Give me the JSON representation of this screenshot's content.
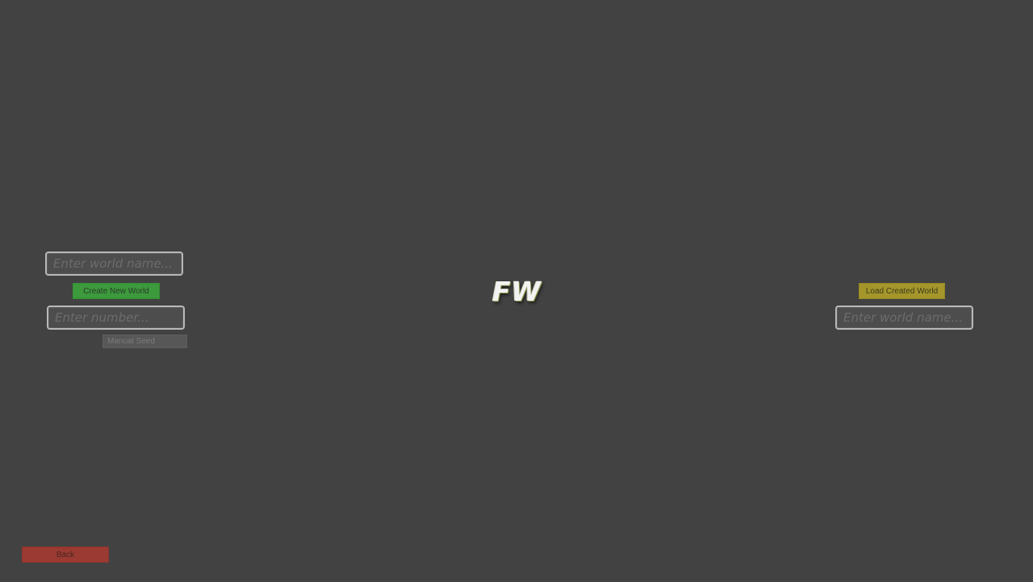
{
  "logo": {
    "text": "FW"
  },
  "create_panel": {
    "world_name_input": {
      "placeholder": "Enter world name...",
      "value": ""
    },
    "create_button_label": "Create New World",
    "seed_input": {
      "placeholder": "Enter number...",
      "value": ""
    },
    "manual_seed_label": "Manual Seed"
  },
  "load_panel": {
    "load_button_label": "Load Created World",
    "world_name_input": {
      "placeholder": "Enter world name...",
      "value": ""
    }
  },
  "footer": {
    "back_button_label": "Back"
  },
  "colors": {
    "background": "#424242",
    "create_button": "#3c9a3c",
    "load_button": "#a4962a",
    "back_button": "#9b3a32",
    "manual_seed_button": "#575757"
  }
}
